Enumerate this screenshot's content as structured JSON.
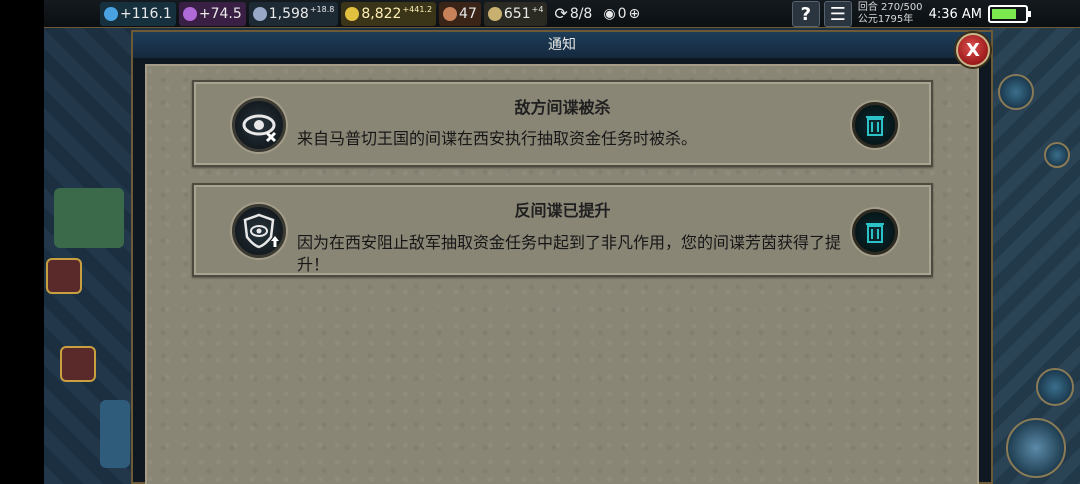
{
  "topbar": {
    "science": "116.1",
    "faith": "74.5",
    "culture": "1,598",
    "culture_rate": "+18.8",
    "gold": "8,822",
    "gold_rate": "+441.2",
    "tourism": "47",
    "favor": "651",
    "favor_rate": "+4",
    "trade_routes": "8/8",
    "spies": "0",
    "help_label": "?",
    "menu_label": "☰",
    "turn": "回合 270/500",
    "year": "公元1795年",
    "clock": "4:36 AM"
  },
  "dialog": {
    "title": "通知",
    "close_label": "X"
  },
  "notifications": [
    {
      "title": "敌方间谍被杀",
      "message": "来自马普切王国的间谍在西安执行抽取资金任务时被杀。"
    },
    {
      "title": "反间谍已提升",
      "message": "因为在西安阻止敌军抽取资金任务中起到了非凡作用，您的间谍芳茵获得了提升！"
    }
  ],
  "colors": {
    "dialog_title_bg": "#1e3d59",
    "card_bg": "#8a8676",
    "close_red": "#c02a2a",
    "battery_green": "#7be84d"
  },
  "icons": [
    "science-icon",
    "faith-icon",
    "culture-icon",
    "gold-icon",
    "tourism-icon",
    "favor-icon",
    "trade-route-icon",
    "spy-icon",
    "eye-killed-icon",
    "shield-eye-promoted-icon",
    "trash-icon"
  ]
}
